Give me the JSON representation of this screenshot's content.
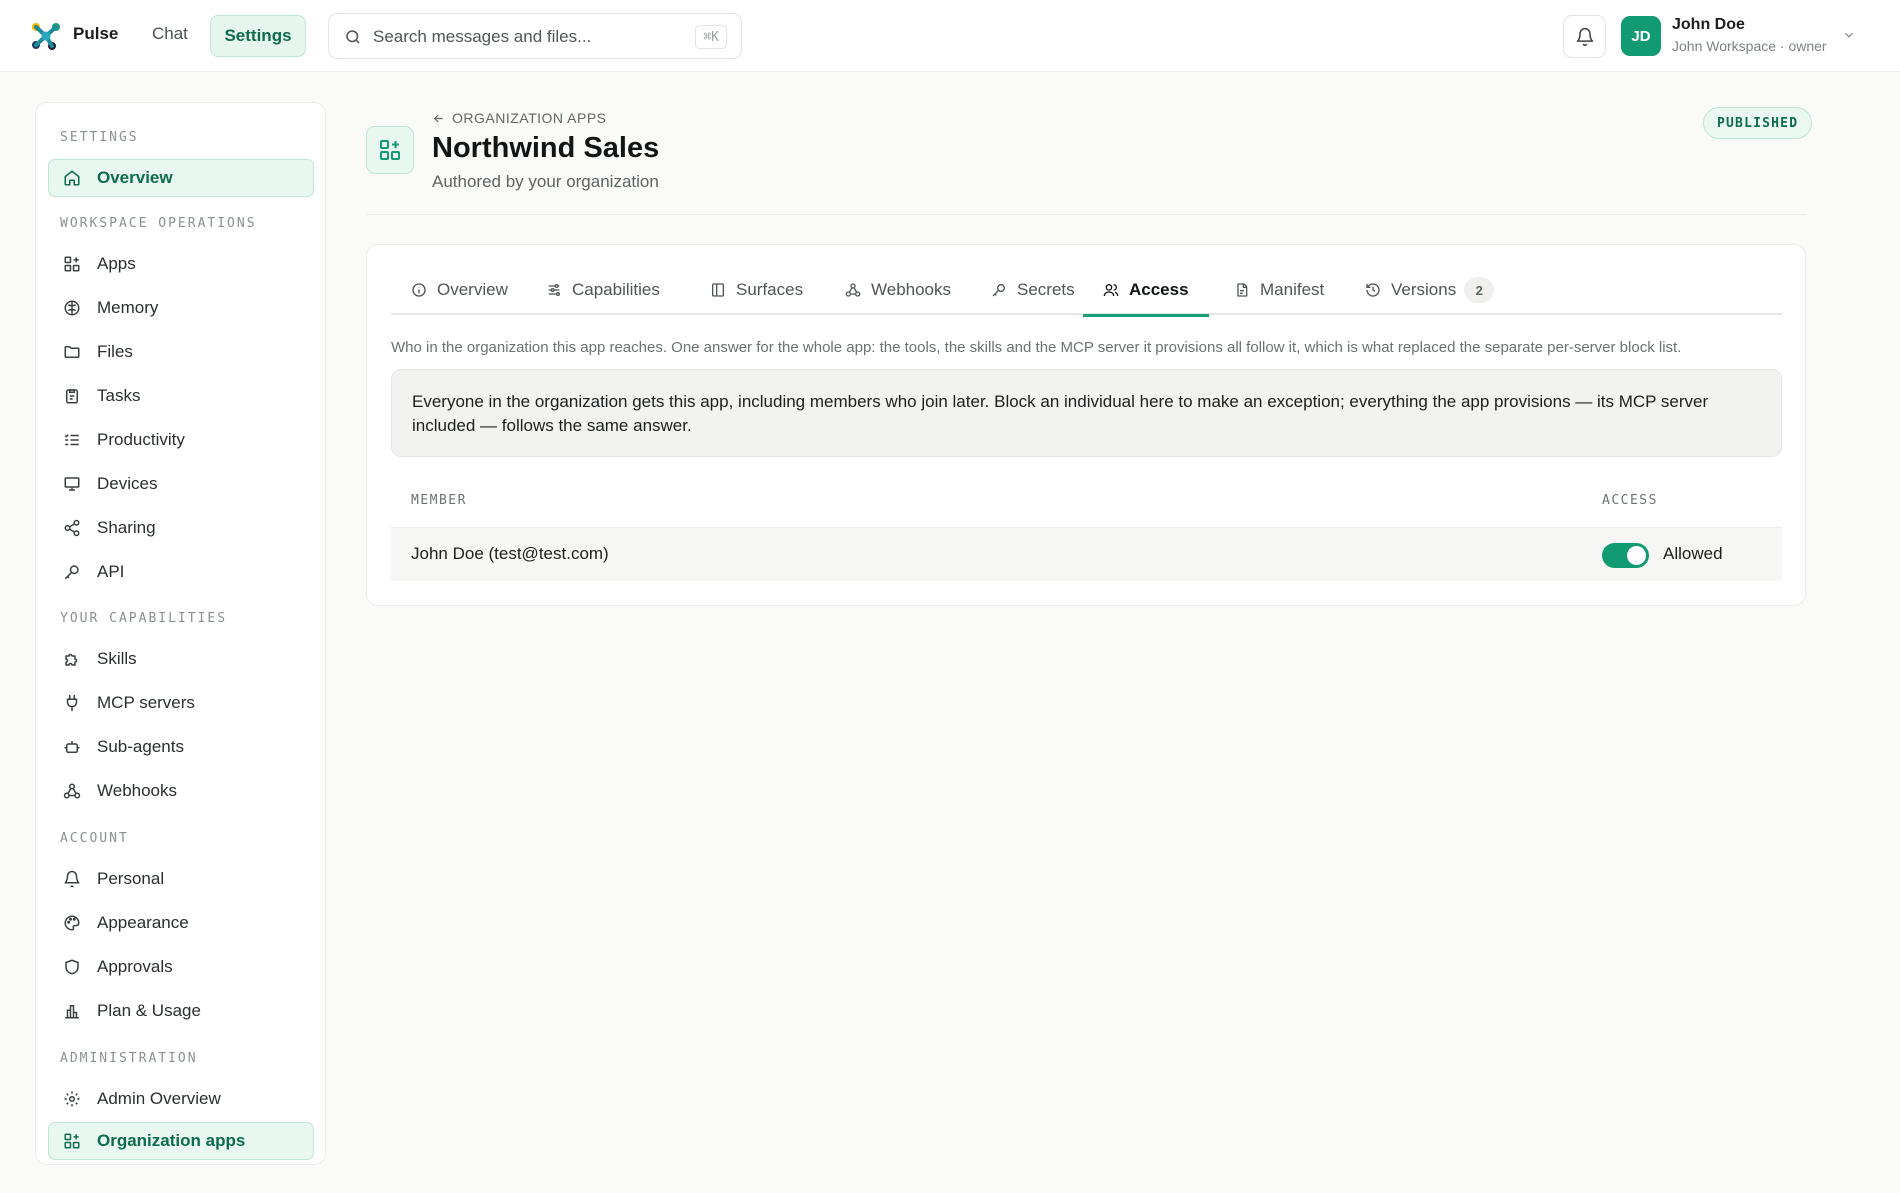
{
  "topbar": {
    "brand": "Pulse",
    "nav": {
      "chat": "Chat",
      "settings": "Settings"
    },
    "search": {
      "placeholder": "Search messages and files...",
      "shortcut": "⌘K"
    },
    "user": {
      "initials": "JD",
      "name": "John Doe",
      "subtitle": "John Workspace · owner"
    }
  },
  "sidebar": {
    "sections": [
      {
        "title": "SETTINGS",
        "items": [
          {
            "label": "Overview",
            "icon": "home-icon",
            "active": true
          }
        ]
      },
      {
        "title": "WORKSPACE OPERATIONS",
        "items": [
          {
            "label": "Apps",
            "icon": "apps-icon"
          },
          {
            "label": "Memory",
            "icon": "brain-icon"
          },
          {
            "label": "Files",
            "icon": "folder-icon"
          },
          {
            "label": "Tasks",
            "icon": "clipboard-icon"
          },
          {
            "label": "Productivity",
            "icon": "list-checks-icon"
          },
          {
            "label": "Devices",
            "icon": "monitor-icon"
          },
          {
            "label": "Sharing",
            "icon": "share-icon"
          },
          {
            "label": "API",
            "icon": "key-icon"
          }
        ]
      },
      {
        "title": "YOUR CAPABILITIES",
        "items": [
          {
            "label": "Skills",
            "icon": "puzzle-icon"
          },
          {
            "label": "MCP servers",
            "icon": "plug-icon"
          },
          {
            "label": "Sub-agents",
            "icon": "bot-icon"
          },
          {
            "label": "Webhooks",
            "icon": "webhook-icon"
          }
        ]
      },
      {
        "title": "ACCOUNT",
        "items": [
          {
            "label": "Personal",
            "icon": "bell-icon"
          },
          {
            "label": "Appearance",
            "icon": "palette-icon"
          },
          {
            "label": "Approvals",
            "icon": "shield-icon"
          },
          {
            "label": "Plan & Usage",
            "icon": "bar-chart-icon"
          }
        ]
      },
      {
        "title": "ADMINISTRATION",
        "items": [
          {
            "label": "Admin Overview",
            "icon": "gear-icon"
          },
          {
            "label": "Organization apps",
            "icon": "apps-icon",
            "active": true
          }
        ]
      }
    ]
  },
  "app": {
    "breadcrumb": "ORGANIZATION APPS",
    "title": "Northwind Sales",
    "subtitle": "Authored by your organization",
    "status": "PUBLISHED"
  },
  "tabs": [
    {
      "label": "Overview",
      "icon": "info-icon"
    },
    {
      "label": "Capabilities",
      "icon": "sliders-icon"
    },
    {
      "label": "Surfaces",
      "icon": "panel-icon"
    },
    {
      "label": "Webhooks",
      "icon": "webhook-icon"
    },
    {
      "label": "Secrets",
      "icon": "key-icon"
    },
    {
      "label": "Access",
      "icon": "users-icon",
      "active": true
    },
    {
      "label": "Manifest",
      "icon": "file-icon"
    },
    {
      "label": "Versions",
      "icon": "history-icon",
      "count": "2"
    }
  ],
  "access": {
    "description": "Who in the organization this app reaches. One answer for the whole app: the tools, the skills and the MCP server it provisions all follow it, which is what replaced the separate per-server block list.",
    "notice": "Everyone in the organization gets this app, including members who join later. Block an individual here to make an exception; everything the app provisions — its MCP server included — follows the same answer.",
    "columns": {
      "member": "MEMBER",
      "access": "ACCESS"
    },
    "rows": [
      {
        "member": "John Doe (test@test.com)",
        "allowed": true,
        "status": "Allowed"
      }
    ]
  },
  "colors": {
    "accent": "#129b73",
    "accent_light": "#e8f7f0",
    "accent_border": "#bfe7d5"
  }
}
